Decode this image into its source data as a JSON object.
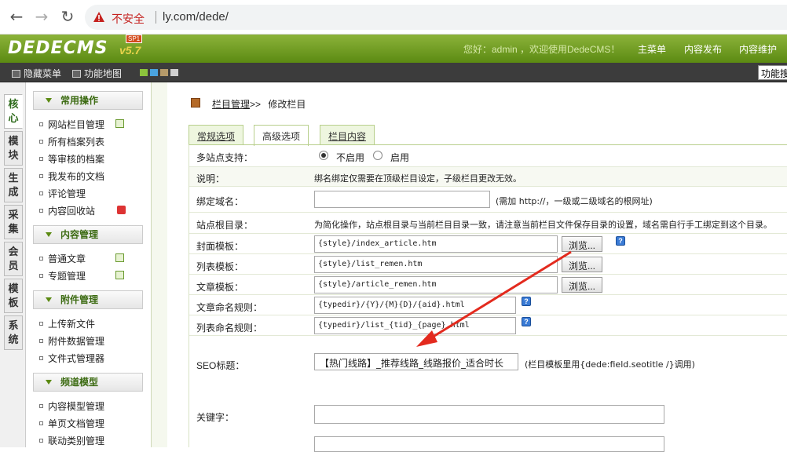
{
  "browser": {
    "security_label": "不安全",
    "url": "ly.com/dede/"
  },
  "header": {
    "logo": "DEDECMS",
    "version": "v5.7",
    "sp": "SP1",
    "welcome": "您好：admin ，欢迎使用DedeCMS！",
    "links": [
      "主菜单",
      "内容发布",
      "内容维护"
    ]
  },
  "toolbar": {
    "hide_menu": "隐藏菜单",
    "function_map": "功能地图",
    "func_search": "功能搜"
  },
  "vtabs": [
    "核心",
    "模块",
    "生成",
    "采集",
    "会员",
    "模板",
    "系统"
  ],
  "menu": {
    "groups": [
      {
        "title": "常用操作",
        "items": [
          "网站栏目管理",
          "所有档案列表",
          "等审核的档案",
          "我发布的文档",
          "评论管理",
          "内容回收站"
        ]
      },
      {
        "title": "内容管理",
        "items": [
          "普通文章",
          "专题管理"
        ]
      },
      {
        "title": "附件管理",
        "items": [
          "上传新文件",
          "附件数据管理",
          "文件式管理器"
        ]
      },
      {
        "title": "频道模型",
        "items": [
          "内容模型管理",
          "单页文档管理",
          "联动类别管理"
        ]
      }
    ]
  },
  "main": {
    "breadcrumb_link": "栏目管理",
    "breadcrumb_sep": ">>",
    "breadcrumb_current": "修改栏目",
    "tabs": [
      "常规选项",
      "高级选项",
      "栏目内容"
    ],
    "multisite_label": "多站点支持：",
    "radio_off": "不启用",
    "radio_on": "启用",
    "note_label": "说明：",
    "note_text": "绑名绑定仅需要在顶级栏目设定，子级栏目更改无效。",
    "domain_label": "绑定域名：",
    "domain_value": "",
    "domain_hint": "(需加 http://，一级或二级域名的根网址)",
    "root_label": "站点根目录：",
    "root_text": "为简化操作，站点根目录与当前栏目目录一致，请注意当前栏目文件保存目录的设置，域名需自行手工绑定到这个目录。",
    "cover_label": "封面模板：",
    "cover_value": "{style}/index_article.htm",
    "list_label": "列表模板：",
    "list_value": "{style}/list_remen.htm",
    "article_label": "文章模板：",
    "article_value": "{style}/article_remen.htm",
    "browse": "浏览...",
    "article_rule_label": "文章命名规则：",
    "article_rule_value": "{typedir}/{Y}/{M}{D}/{aid}.html",
    "list_rule_label": "列表命名规则：",
    "list_rule_value": "{typedir}/list_{tid}_{page}.html",
    "seo_label": "SEO标题：",
    "seo_value": "【热门线路】_推荐线路_线路报价_适合时长",
    "seo_hint": "(栏目模板里用{dede:field.seotitle /}调用)",
    "keywords_label": "关键字："
  },
  "colors": {
    "header_green": "#6b9a1e",
    "arrow": "#e32a1e"
  }
}
